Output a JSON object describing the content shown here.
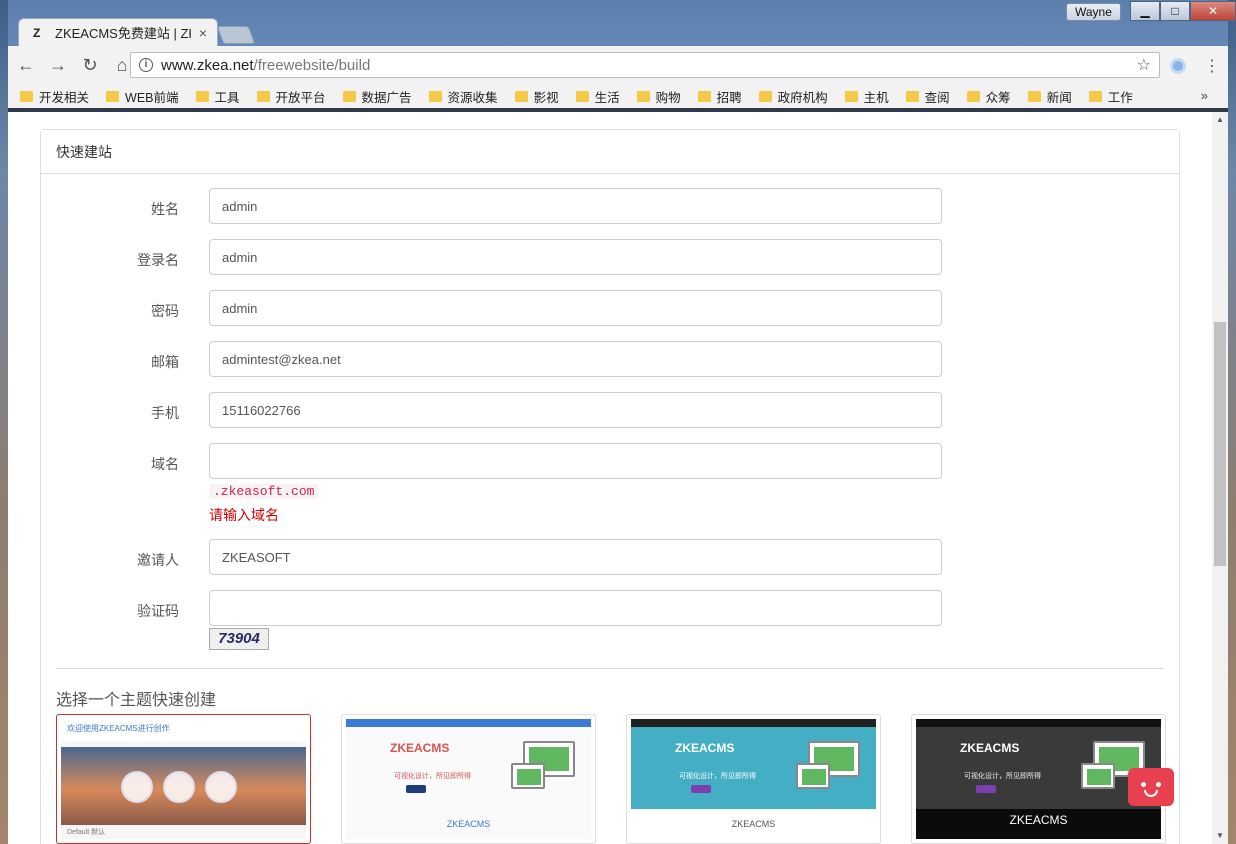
{
  "browser": {
    "tab_title": "ZKEACMS免费建站 | ZK",
    "tab_favicon": "Z",
    "tab_close": "×",
    "profile_name": "Wayne",
    "window_buttons": {
      "minimize": "▁",
      "maximize": "□",
      "close": "✕"
    },
    "url_host": "www.zkea.net",
    "url_path": "/freewebsite/build",
    "bookmarks": [
      "开发相关",
      "WEB前端",
      "工具",
      "开放平台",
      "数据广告",
      "资源收集",
      "影视",
      "生活",
      "购物",
      "招聘",
      "政府机构",
      "主机",
      "查阅",
      "众筹",
      "新闻",
      "工作"
    ],
    "bookmarks_more": "»",
    "icons": {
      "back": "back-arrow-icon",
      "forward": "forward-arrow-icon",
      "reload": "reload-icon",
      "home": "home-icon",
      "info": "info-icon",
      "star": "star-icon",
      "menu": "menu-dots-icon"
    }
  },
  "form": {
    "panel_title": "快速建站",
    "fields": {
      "name": {
        "label": "姓名",
        "value": "admin"
      },
      "login": {
        "label": "登录名",
        "value": "admin"
      },
      "password": {
        "label": "密码",
        "value": "admin"
      },
      "email": {
        "label": "邮箱",
        "value": "admintest@zkea.net"
      },
      "phone": {
        "label": "手机",
        "value": "15116022766"
      },
      "domain": {
        "label": "域名",
        "value": "",
        "suffix": ".zkeasoft.com",
        "error": "请输入域名"
      },
      "inviter": {
        "label": "邀请人",
        "value": "ZKEASOFT"
      },
      "captcha": {
        "label": "验证码",
        "value": "",
        "image_text": "73904"
      }
    }
  },
  "themes": {
    "section_title": "选择一个主题快速创建",
    "cards": [
      {
        "header_text": "欢迎使用ZKEACMS进行创作",
        "footer_text": "Default 默认",
        "selected": true
      },
      {
        "brand": "ZKEACMS",
        "sub": "可视化设计，所见即所得",
        "bottom": "ZKEACMS",
        "selected": false
      },
      {
        "brand": "ZKEACMS",
        "sub": "可视化设计，所见即所得",
        "bottom": "ZKEACMS",
        "selected": false
      },
      {
        "brand": "ZKEACMS",
        "sub": "可视化设计，所见即所得",
        "bottom": "ZKEACMS",
        "selected": false
      }
    ]
  },
  "colors": {
    "error": "#d40000",
    "suffix_text": "#c7254e",
    "selected_border": "#c9302c",
    "chat_widget": "#e8404e"
  }
}
